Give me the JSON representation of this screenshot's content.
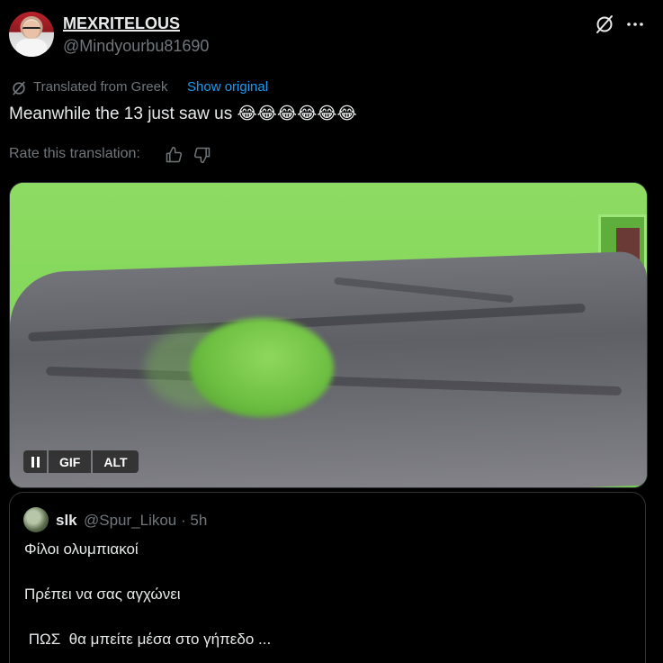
{
  "author": {
    "display_name": "MEXRITELOUS",
    "handle": "@Mindyourbu81690"
  },
  "translation": {
    "notice": "Translated from Greek",
    "show_original": "Show original",
    "text": "Meanwhile the 13 just saw us 😂😂😂😂😂😂",
    "rate_label": "Rate this translation:"
  },
  "media": {
    "pause_icon": "pause-icon",
    "gif_label": "GIF",
    "alt_label": "ALT"
  },
  "quote": {
    "name": "slk",
    "handle_time": "@Spur_Likou · 5h",
    "line1": "Φίλοι ολυμπιακοί",
    "line2": "Πρέπει να σας αγχώνει",
    "line3": " ΠΩΣ  θα μπείτε μέσα στο γήπεδο ..."
  },
  "icons": {
    "header_grok": "grok-icon",
    "header_more": "more-icon",
    "translate": "translate-icon",
    "thumbs_up": "thumbs-up-icon",
    "thumbs_down": "thumbs-down-icon"
  },
  "colors": {
    "background": "#000000",
    "text_primary": "#e7e9ea",
    "text_secondary": "#71767b",
    "link": "#1d9bf0",
    "border": "#2f3336"
  }
}
